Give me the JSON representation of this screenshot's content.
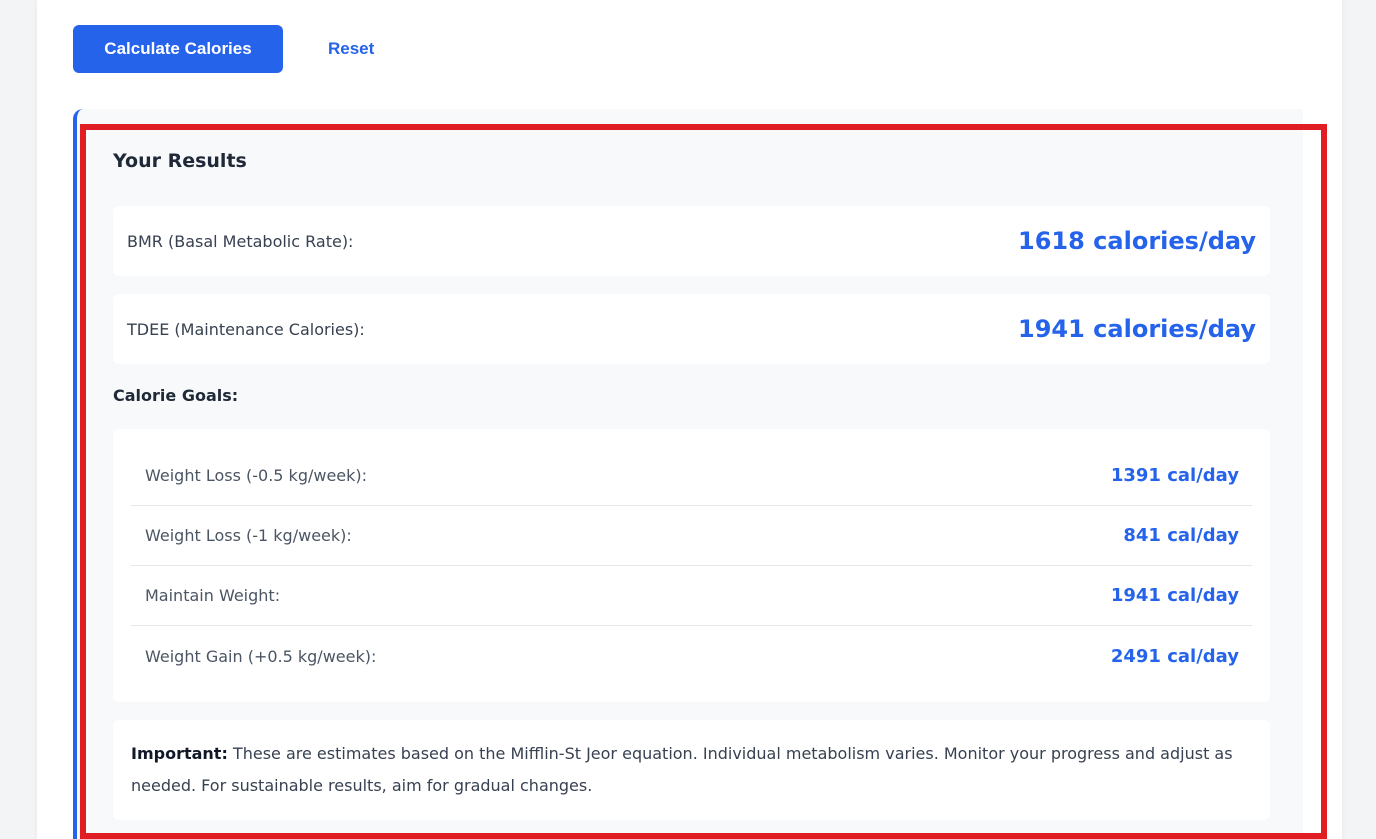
{
  "actions": {
    "calculate_label": "Calculate Calories",
    "reset_label": "Reset"
  },
  "results": {
    "title": "Your Results",
    "bmr": {
      "label": "BMR (Basal Metabolic Rate):",
      "value": "1618 calories/day"
    },
    "tdee": {
      "label": "TDEE (Maintenance Calories):",
      "value": "1941 calories/day"
    },
    "goals_title": "Calorie Goals:",
    "goals": [
      {
        "label": "Weight Loss (-0.5 kg/week):",
        "value": "1391 cal/day"
      },
      {
        "label": "Weight Loss (-1 kg/week):",
        "value": "841 cal/day"
      },
      {
        "label": "Maintain Weight:",
        "value": "1941 cal/day"
      },
      {
        "label": "Weight Gain (+0.5 kg/week):",
        "value": "2491 cal/day"
      }
    ],
    "note": {
      "prefix": "Important:",
      "text": " These are estimates based on the Mifflin-St Jeor equation. Individual metabolism varies. Monitor your progress and adjust as needed. For sustainable results, aim for gradual changes."
    }
  },
  "colors": {
    "accent": "#2563eb",
    "highlight_border": "#e11d24",
    "panel_background": "#f8f9fb"
  }
}
